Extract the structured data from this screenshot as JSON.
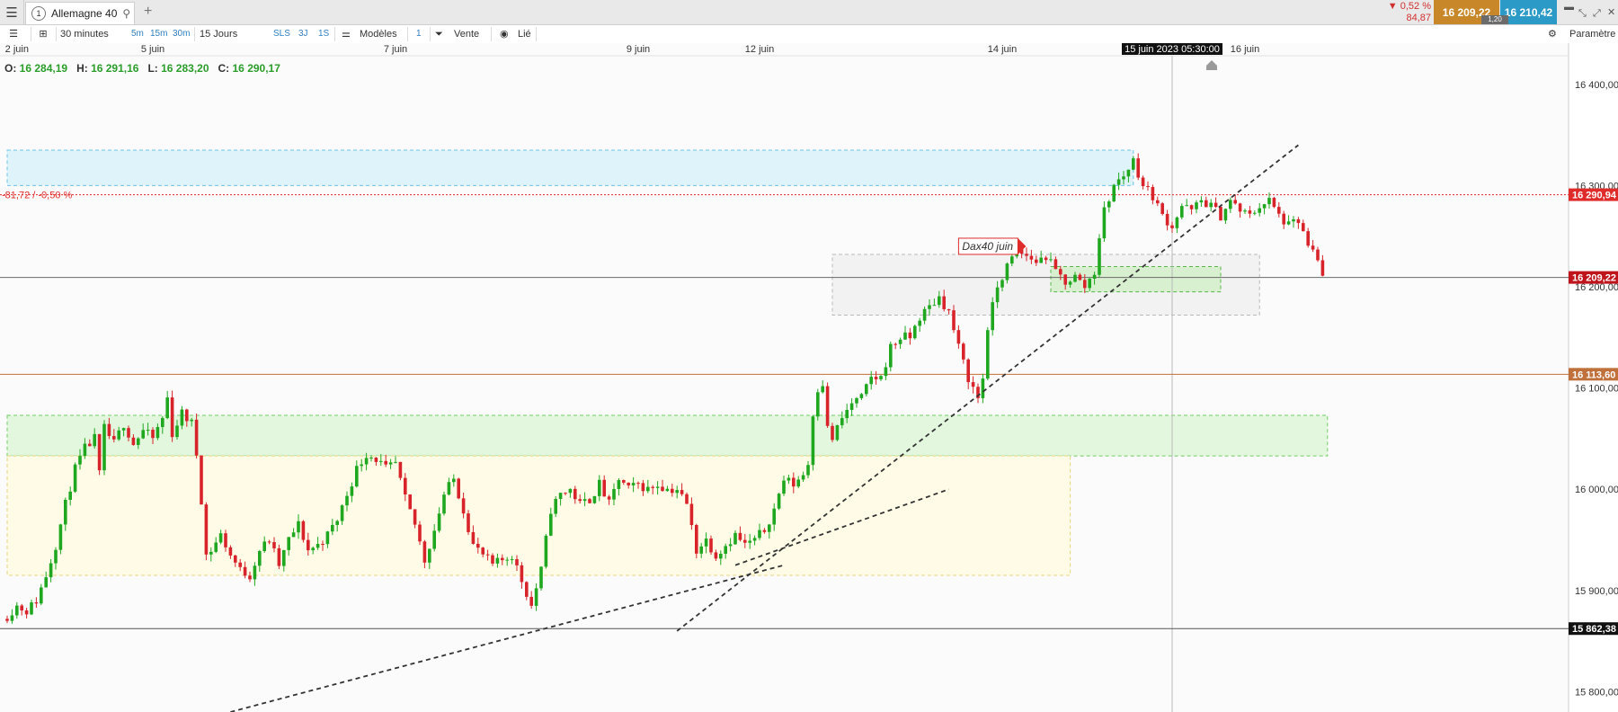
{
  "tabbar": {
    "tab_number": "1",
    "tab_title": "Allemagne 40",
    "menu_icon": "hamburger-icon",
    "search_icon": "search-icon",
    "add_icon": "plus-icon"
  },
  "quote": {
    "change_pct": "▼ 0,52 %",
    "change_abs": "84,87",
    "bid": "16 209,22",
    "ask": "16 210,42",
    "spread": "1,20"
  },
  "toolbar": {
    "interval": "30 minutes",
    "quick_5m": "5m",
    "quick_15m": "15m",
    "quick_30m": "30m",
    "period": "15 Jours",
    "sls": "SLS",
    "p3j": "3J",
    "p1s": "1S",
    "models": "Modèles",
    "one": "1",
    "sell": "Vente",
    "linked": "Lié",
    "params": "Paramètre"
  },
  "chart_data": {
    "type": "candlestick",
    "instrument": "Allemagne 40",
    "interval": "30 minutes",
    "ohlc_label": {
      "o_label": "O:",
      "o": "16 284,19",
      "h_label": "H:",
      "h": "16 291,16",
      "l_label": "L:",
      "l": "16 283,20",
      "c_label": "C:",
      "c": "16 290,17"
    },
    "x_ticks": [
      "2 juin",
      "5 juin",
      "7 juin",
      "9 juin",
      "12 juin",
      "14 juin",
      "16 juin"
    ],
    "crosshair_time": "15 juin 2023 05:30:00",
    "ylim": [
      15780,
      16430
    ],
    "y_ticks": [
      "16 400,00",
      "16 300,00",
      "16 200,00",
      "16 100,00",
      "16 000,00",
      "15 900,00",
      "15 800,00"
    ],
    "y_tick_values": [
      16400,
      16300,
      16200,
      16100,
      16000,
      15900,
      15800
    ],
    "price_tags": [
      {
        "label": "16 290,94",
        "value": 16290.94,
        "color": "#e02b2b"
      },
      {
        "label": "16 209,22",
        "value": 16209.22,
        "color": "#c0141c"
      },
      {
        "label": "16 113,60",
        "value": 16113.6,
        "color": "#c0703a"
      },
      {
        "label": "15 862,38",
        "value": 15862.38,
        "color": "#111111"
      }
    ],
    "prev_close_label": "-81,72 / -0,50 %",
    "annotation": "Dax40 juin",
    "close_path": [
      [
        0,
        15875
      ],
      [
        2,
        15885
      ],
      [
        4,
        15880
      ],
      [
        6,
        15890
      ],
      [
        8,
        15915
      ],
      [
        10,
        15945
      ],
      [
        12,
        15985
      ],
      [
        14,
        16020
      ],
      [
        16,
        16040
      ],
      [
        18,
        16050
      ],
      [
        19,
        16015
      ],
      [
        20,
        16060
      ],
      [
        22,
        16045
      ],
      [
        24,
        16065
      ],
      [
        26,
        16045
      ],
      [
        28,
        16058
      ],
      [
        30,
        16050
      ],
      [
        32,
        16070
      ],
      [
        33,
        16090
      ],
      [
        34,
        16055
      ],
      [
        36,
        16075
      ],
      [
        38,
        16065
      ],
      [
        39,
        16035
      ],
      [
        40,
        15990
      ],
      [
        41,
        15935
      ],
      [
        42,
        15940
      ],
      [
        44,
        15955
      ],
      [
        46,
        15935
      ],
      [
        48,
        15920
      ],
      [
        50,
        15915
      ],
      [
        52,
        15940
      ],
      [
        54,
        15950
      ],
      [
        56,
        15925
      ],
      [
        58,
        15950
      ],
      [
        60,
        15965
      ],
      [
        62,
        15940
      ],
      [
        64,
        15945
      ],
      [
        66,
        15955
      ],
      [
        68,
        15970
      ],
      [
        70,
        15995
      ],
      [
        72,
        16020
      ],
      [
        74,
        16035
      ],
      [
        76,
        16030
      ],
      [
        78,
        16020
      ],
      [
        80,
        16025
      ],
      [
        82,
        15990
      ],
      [
        84,
        15965
      ],
      [
        86,
        15930
      ],
      [
        88,
        15960
      ],
      [
        90,
        15995
      ],
      [
        92,
        16010
      ],
      [
        94,
        15980
      ],
      [
        96,
        15945
      ],
      [
        98,
        15935
      ],
      [
        100,
        15925
      ],
      [
        102,
        15930
      ],
      [
        104,
        15935
      ],
      [
        106,
        15910
      ],
      [
        108,
        15885
      ],
      [
        110,
        15920
      ],
      [
        112,
        15980
      ],
      [
        114,
        15995
      ],
      [
        116,
        16000
      ],
      [
        118,
        15985
      ],
      [
        120,
        15990
      ],
      [
        122,
        16005
      ],
      [
        124,
        15985
      ],
      [
        126,
        16010
      ],
      [
        128,
        16000
      ],
      [
        130,
        16005
      ],
      [
        132,
        16000
      ],
      [
        134,
        16005
      ],
      [
        136,
        16000
      ],
      [
        138,
        16000
      ],
      [
        140,
        15985
      ],
      [
        142,
        15940
      ],
      [
        144,
        15950
      ],
      [
        146,
        15935
      ],
      [
        148,
        15945
      ],
      [
        150,
        15955
      ],
      [
        152,
        15945
      ],
      [
        154,
        15950
      ],
      [
        156,
        15960
      ],
      [
        158,
        15980
      ],
      [
        160,
        16010
      ],
      [
        162,
        16005
      ],
      [
        164,
        16015
      ],
      [
        165,
        16025
      ],
      [
        166,
        16075
      ],
      [
        167,
        16100
      ],
      [
        168,
        16105
      ],
      [
        169,
        16060
      ],
      [
        170,
        16050
      ],
      [
        172,
        16070
      ],
      [
        174,
        16085
      ],
      [
        176,
        16090
      ],
      [
        178,
        16110
      ],
      [
        180,
        16110
      ],
      [
        182,
        16140
      ],
      [
        184,
        16150
      ],
      [
        186,
        16150
      ],
      [
        188,
        16170
      ],
      [
        190,
        16180
      ],
      [
        192,
        16190
      ],
      [
        194,
        16175
      ],
      [
        196,
        16140
      ],
      [
        198,
        16110
      ],
      [
        200,
        16090
      ],
      [
        201,
        16110
      ],
      [
        202,
        16160
      ],
      [
        204,
        16200
      ],
      [
        206,
        16220
      ],
      [
        208,
        16235
      ],
      [
        210,
        16230
      ],
      [
        212,
        16225
      ],
      [
        214,
        16230
      ],
      [
        216,
        16215
      ],
      [
        218,
        16205
      ],
      [
        220,
        16210
      ],
      [
        222,
        16200
      ],
      [
        224,
        16215
      ],
      [
        225,
        16250
      ],
      [
        226,
        16275
      ],
      [
        228,
        16300
      ],
      [
        230,
        16310
      ],
      [
        232,
        16325
      ],
      [
        234,
        16300
      ],
      [
        236,
        16290
      ],
      [
        238,
        16270
      ],
      [
        240,
        16260
      ],
      [
        242,
        16280
      ],
      [
        244,
        16275
      ],
      [
        246,
        16285
      ],
      [
        248,
        16280
      ],
      [
        250,
        16270
      ],
      [
        252,
        16285
      ],
      [
        254,
        16275
      ],
      [
        256,
        16270
      ],
      [
        258,
        16280
      ],
      [
        260,
        16285
      ],
      [
        262,
        16270
      ],
      [
        264,
        16260
      ],
      [
        266,
        16265
      ],
      [
        268,
        16240
      ],
      [
        270,
        16225
      ],
      [
        271,
        16209
      ]
    ],
    "zones": [
      {
        "name": "resistance-zone",
        "y1": 16300,
        "y2": 16335,
        "x1": 0,
        "x2": 232,
        "fill": "#dff3fb",
        "stroke": "#6cc4e6"
      },
      {
        "name": "consolidation-zone",
        "y1": 16172,
        "y2": 16232,
        "x1": 170,
        "x2": 258,
        "fill": "#f2f2f2",
        "stroke": "#b9b9b9"
      },
      {
        "name": "inner-green-zone",
        "y1": 16195,
        "y2": 16220,
        "x1": 215,
        "x2": 250,
        "fill": "#d8f0d0",
        "stroke": "#59b54a"
      },
      {
        "name": "support-zone",
        "y1": 16033,
        "y2": 16073,
        "x1": 0,
        "x2": 272,
        "fill": "#e3f7df",
        "stroke": "#72cd64"
      },
      {
        "name": "range-zone",
        "y1": 15915,
        "y2": 16033,
        "x1": 0,
        "x2": 219,
        "fill": "#fffbe6",
        "stroke": "#e9d57c"
      }
    ],
    "trendlines": [
      {
        "name": "long-trendline",
        "x1": 46,
        "y1": 15780,
        "x2": 160,
        "y2": 15925
      },
      {
        "name": "steep-trendline",
        "x1": 138,
        "y1": 15860,
        "x2": 266,
        "y2": 16340
      },
      {
        "name": "short-trendline",
        "x1": 150,
        "y1": 15925,
        "x2": 194,
        "y2": 16000
      }
    ]
  }
}
